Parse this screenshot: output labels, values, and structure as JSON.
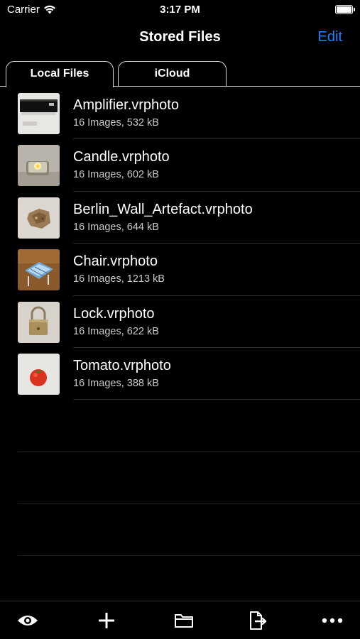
{
  "status": {
    "carrier": "Carrier",
    "time": "3:17 PM"
  },
  "nav": {
    "title": "Stored Files",
    "edit_label": "Edit"
  },
  "tabs": [
    {
      "label": "Local Files",
      "active": true
    },
    {
      "label": "iCloud",
      "active": false
    }
  ],
  "files": [
    {
      "name": "Amplifier.vrphoto",
      "info": "16 Images, 532 kB",
      "thumb": "amplifier"
    },
    {
      "name": "Candle.vrphoto",
      "info": "16 Images, 602 kB",
      "thumb": "candle"
    },
    {
      "name": "Berlin_Wall_Artefact.vrphoto",
      "info": "16 Images, 644 kB",
      "thumb": "berlin-wall-artefact"
    },
    {
      "name": "Chair.vrphoto",
      "info": "16 Images, 1213 kB",
      "thumb": "chair"
    },
    {
      "name": "Lock.vrphoto",
      "info": "16 Images, 622 kB",
      "thumb": "lock"
    },
    {
      "name": "Tomato.vrphoto",
      "info": "16 Images, 388 kB",
      "thumb": "tomato"
    }
  ],
  "toolbar": {
    "icons": [
      "eye-icon",
      "plus-icon",
      "folder-icon",
      "export-icon",
      "more-icon"
    ]
  },
  "colors": {
    "accent": "#1a82ff",
    "background": "#000000",
    "separator": "#2b2b2b"
  }
}
